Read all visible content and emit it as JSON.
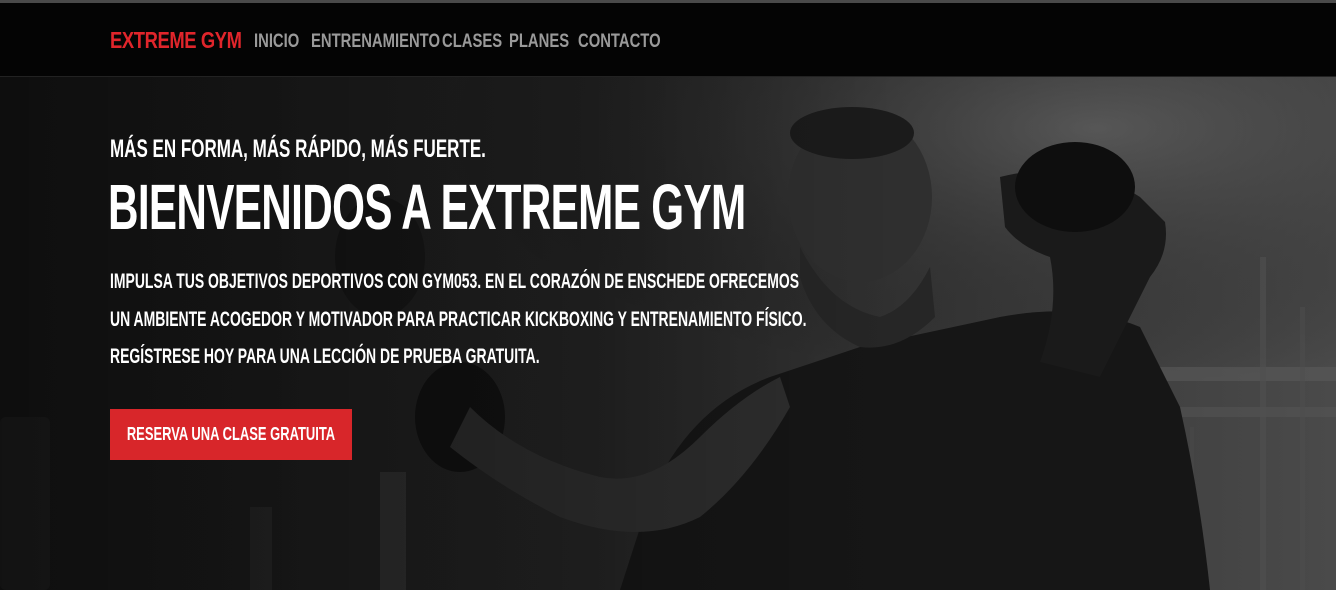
{
  "navbar": {
    "brand": "EXTREME GYM",
    "links": [
      "INICIO",
      "ENTRENAMIENTO",
      "CLASES",
      "PLANES",
      "CONTACTO"
    ]
  },
  "hero": {
    "tagline": "MÁS EN FORMA, MÁS RÁPIDO, MÁS FUERTE.",
    "headline": "BIENVENIDOS A EXTREME GYM",
    "description": "IMPULSA TUS OBJETIVOS DEPORTIVOS CON GYM053. EN EL CORAZÓN DE ENSCHEDE OFRECEMOS UN AMBIENTE ACOGEDOR Y MOTIVADOR PARA PRACTICAR KICKBOXING Y ENTRENAMIENTO FÍSICO. REGÍSTRESE HOY PARA UNA LECCIÓN DE PRUEBA GRATUITA.",
    "cta_label": "RESERVA UNA CLASE GRATUITA"
  },
  "colors": {
    "accent": "#d8262a",
    "brand": "#e0252b",
    "nav_background": "#040404",
    "nav_text": "#9a9a9a",
    "hero_text": "#ffffff"
  }
}
